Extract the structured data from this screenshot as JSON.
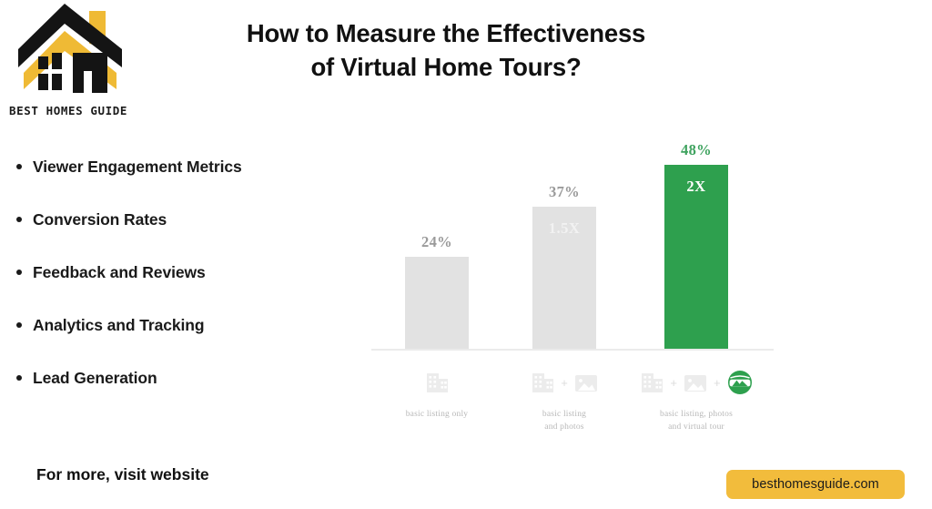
{
  "brand": {
    "wordmark": "BEST HOMES GUIDE",
    "logo_icon": "house-roof-logo-icon",
    "accent_yellow": "#f2bc3c",
    "dark": "#1b1b1b"
  },
  "header": {
    "title_line1": "How to Measure the Effectiveness",
    "title_line2": "of Virtual Home Tours?"
  },
  "bullets": [
    {
      "label": "Viewer Engagement Metrics"
    },
    {
      "label": "Conversion Rates"
    },
    {
      "label": "Feedback and Reviews"
    },
    {
      "label": "Analytics and Tracking"
    },
    {
      "label": "Lead Generation"
    }
  ],
  "footer": {
    "cta": "For more, visit website",
    "website": "besthomesguide.com"
  },
  "chart_data": {
    "type": "bar",
    "title": "",
    "xlabel": "",
    "ylabel": "",
    "ylim": [
      0,
      60
    ],
    "grid": false,
    "legend": "none",
    "categories": [
      "basic listing only",
      "basic listing\nand photos",
      "basic listing, photos\nand virtual tour"
    ],
    "category_lines": [
      [
        "basic listing only",
        ""
      ],
      [
        "basic listing",
        "and photos"
      ],
      [
        "basic listing, photos",
        "and virtual tour"
      ]
    ],
    "values": [
      24,
      37,
      48
    ],
    "value_labels": [
      "24%",
      "37%",
      "48%"
    ],
    "inner_labels": [
      "",
      "1.5X",
      "2X"
    ],
    "bar_colors": [
      "#e2e2e2",
      "#e2e2e2",
      "#2ea04e"
    ],
    "label_colors": [
      "#9a9a9a",
      "#9a9a9a",
      "#3fa35f"
    ],
    "icons": [
      [
        "building-icon"
      ],
      [
        "building-icon",
        "plus-icon",
        "photo-icon"
      ],
      [
        "building-icon",
        "plus-icon",
        "photo-icon",
        "plus-icon",
        "virtual-tour-icon"
      ]
    ]
  }
}
